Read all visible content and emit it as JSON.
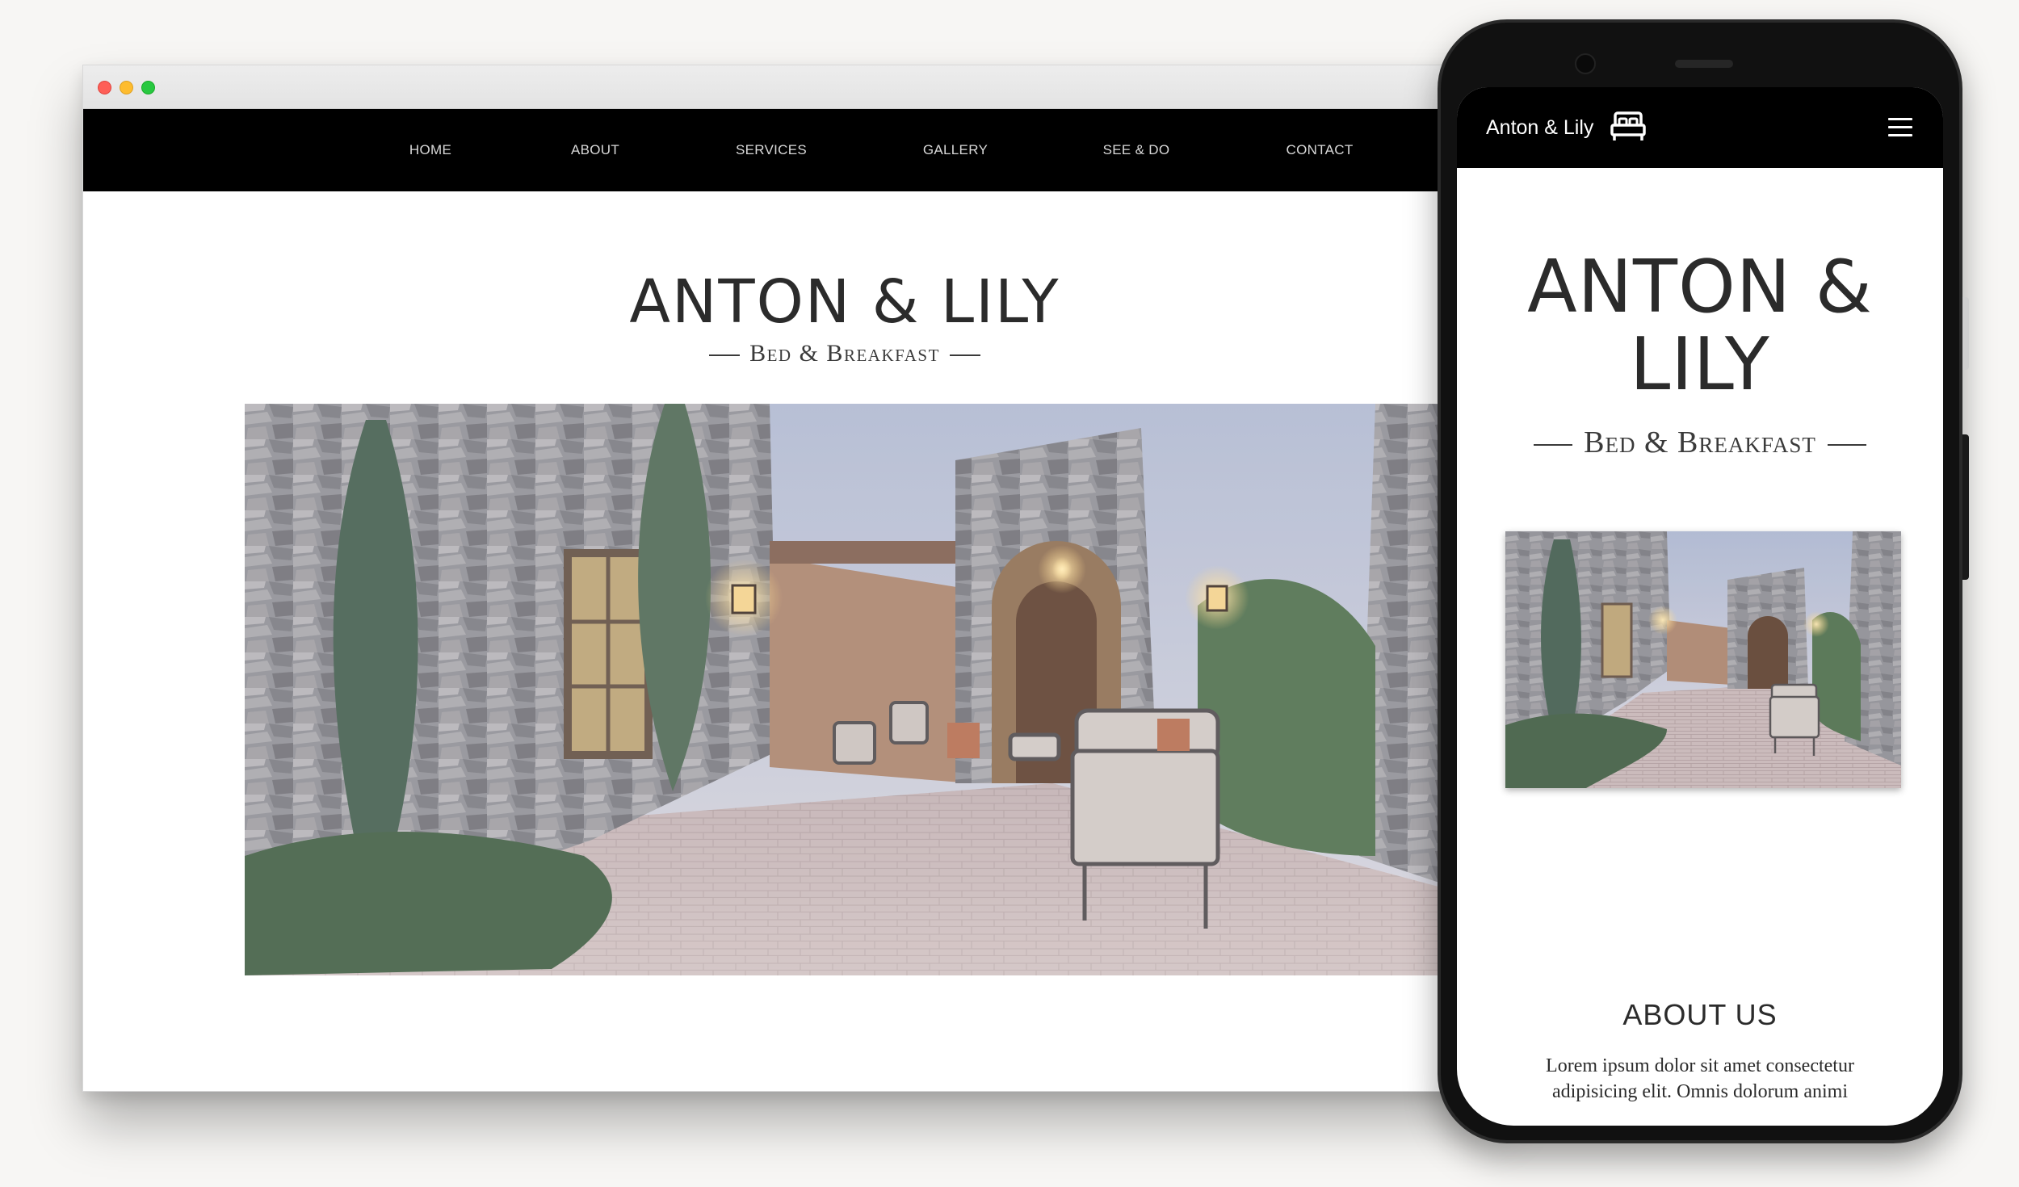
{
  "desktop": {
    "nav": {
      "items": [
        "HOME",
        "ABOUT",
        "SERVICES",
        "GALLERY",
        "SEE & DO",
        "CONTACT"
      ]
    },
    "brand": {
      "title": "ANTON & LILY",
      "subtitle": "Bed & Breakfast"
    }
  },
  "mobile": {
    "nav": {
      "brand": "Anton & Lily",
      "bed_icon": "bed-icon",
      "menu_icon": "hamburger-menu-icon"
    },
    "brand": {
      "title": "ANTON & LILY",
      "subtitle": "Bed & Breakfast"
    },
    "about": {
      "heading": "ABOUT US",
      "body": "Lorem ipsum dolor sit amet consectetur adipisicing elit. Omnis dolorum animi"
    }
  },
  "colors": {
    "navbar": "#000000",
    "background": "#f7f6f4",
    "title_text": "#2b2b2b"
  }
}
